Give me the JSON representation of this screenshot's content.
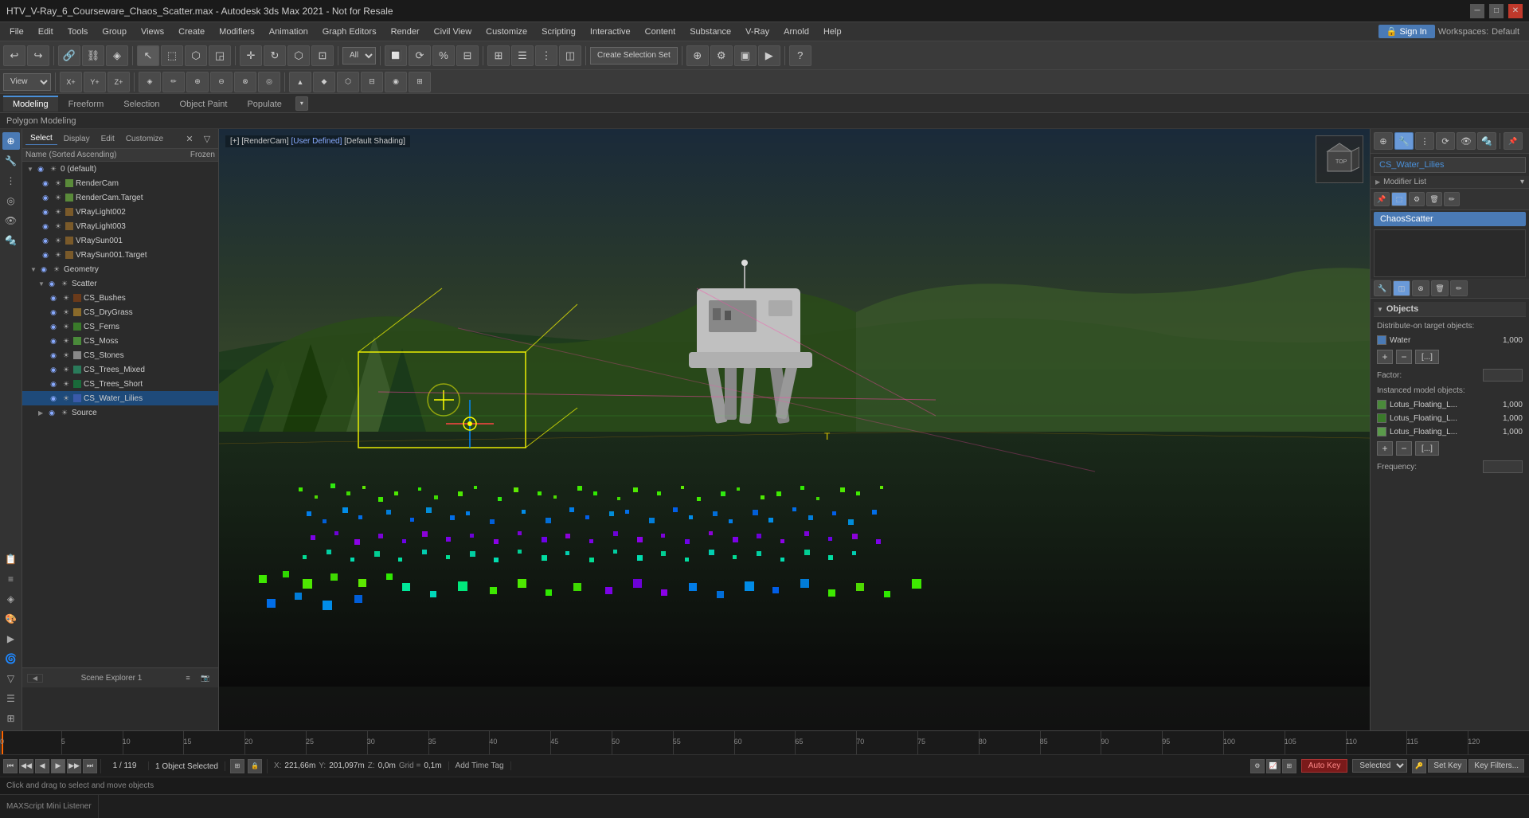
{
  "titleBar": {
    "title": "HTV_V-Ray_6_Courseware_Chaos_Scatter.max - Autodesk 3ds Max 2021 - Not for Resale",
    "minimize": "─",
    "maximize": "□",
    "close": "✕"
  },
  "menuBar": {
    "items": [
      "File",
      "Edit",
      "Tools",
      "Group",
      "Views",
      "Create",
      "Modifiers",
      "Animation",
      "Graph Editors",
      "Render",
      "Civil View",
      "Customize",
      "Scripting",
      "Interactive",
      "Content",
      "Substance",
      "V-Ray",
      "Arnold",
      "Help"
    ]
  },
  "signin": {
    "label": "🔒 Sign In",
    "workspaces": "Workspaces:",
    "workspaceValue": "Default"
  },
  "toolbar1": {
    "buttons": [
      "↩",
      "↪",
      "🔗",
      "🔗",
      "~",
      "▼",
      "■",
      "◆",
      "▲",
      "◎",
      "⚙",
      "⟳",
      "◎",
      "✦",
      "◈",
      "◫",
      "★",
      "❖",
      "⊕",
      "⊗",
      "⊘",
      "⊙"
    ],
    "dropdown": "All",
    "createSelectionSet": "Create Selection Set"
  },
  "toolbar2": {
    "viewportDropdown": "View",
    "buttons": [
      "⊕",
      "⊞",
      "◫",
      "◧",
      "⊟",
      "⊠"
    ]
  },
  "tabs": {
    "items": [
      "Modeling",
      "Freeform",
      "Selection",
      "Object Paint",
      "Populate"
    ],
    "activeIndex": 0,
    "dropdownIcon": "▾"
  },
  "subTitle": {
    "text": "Polygon Modeling"
  },
  "viewport": {
    "label": "[+] [RenderCam] [User Defined] [Default Shading]",
    "parts": {
      "plus": "[+]",
      "renderCam": "[RenderCam]",
      "userDefined": "[User Defined]",
      "defaultShading": "[Default Shading]"
    }
  },
  "sceneExplorer": {
    "title": "Scene Explorer 1",
    "headerTabs": [
      "Select",
      "Display",
      "Edit",
      "Customize"
    ],
    "columnHeaders": {
      "name": "Name (Sorted Ascending)",
      "frozen": "Frozen"
    },
    "items": [
      {
        "id": "0-default",
        "name": "0 (default)",
        "indent": 0,
        "type": "layer",
        "hasArrow": true,
        "expanded": true
      },
      {
        "id": "render-cam",
        "name": "RenderCam",
        "indent": 2,
        "type": "object",
        "hasArrow": false
      },
      {
        "id": "render-cam-target",
        "name": "RenderCam.Target",
        "indent": 2,
        "type": "object",
        "hasArrow": false
      },
      {
        "id": "vray-light002",
        "name": "VRayLight002",
        "indent": 2,
        "type": "object",
        "hasArrow": false
      },
      {
        "id": "vray-light003",
        "name": "VRayLight003",
        "indent": 2,
        "type": "object",
        "hasArrow": false
      },
      {
        "id": "vray-sun001",
        "name": "VRaySun001",
        "indent": 2,
        "type": "object",
        "hasArrow": false
      },
      {
        "id": "vray-sun001-target",
        "name": "VRaySun001.Target",
        "indent": 2,
        "type": "object",
        "hasArrow": false
      },
      {
        "id": "geometry",
        "name": "Geometry",
        "indent": 1,
        "type": "group",
        "hasArrow": true,
        "expanded": true
      },
      {
        "id": "scatter",
        "name": "Scatter",
        "indent": 2,
        "type": "group",
        "hasArrow": true,
        "expanded": true
      },
      {
        "id": "cs-bushes",
        "name": "CS_Bushes",
        "indent": 3,
        "type": "object"
      },
      {
        "id": "cs-drygrass",
        "name": "CS_DryGrass",
        "indent": 3,
        "type": "object"
      },
      {
        "id": "cs-ferns",
        "name": "CS_Ferns",
        "indent": 3,
        "type": "object"
      },
      {
        "id": "cs-moss",
        "name": "CS_Moss",
        "indent": 3,
        "type": "object"
      },
      {
        "id": "cs-stones",
        "name": "CS_Stones",
        "indent": 3,
        "type": "object"
      },
      {
        "id": "cs-trees-mixed",
        "name": "CS_Trees_Mixed",
        "indent": 3,
        "type": "object"
      },
      {
        "id": "cs-trees-short",
        "name": "CS_Trees_Short",
        "indent": 3,
        "type": "object"
      },
      {
        "id": "cs-water-lilies",
        "name": "CS_Water_Lilies",
        "indent": 3,
        "type": "object",
        "selected": true
      },
      {
        "id": "source",
        "name": "Source",
        "indent": 2,
        "type": "group",
        "hasArrow": true
      }
    ],
    "footer": {
      "navLabel": "Scene Explorer 1",
      "page": "1 / 119"
    }
  },
  "rightPanel": {
    "objectName": "CS_Water_Lilies",
    "modifierListLabel": "Modifier List",
    "modifierItem": "ChaosScatter",
    "objectsSection": {
      "title": "Objects",
      "distributeLabel": "Distribute-on target objects:",
      "targetObjects": [
        {
          "name": "Water",
          "value": "1,000",
          "color": "#4a7ab5"
        }
      ],
      "instancedLabel": "Instanced model objects:",
      "instancedObjects": [
        {
          "name": "Lotus_Floating_L...",
          "value": "1,000",
          "color": "#4a8a3a"
        },
        {
          "name": "Lotus_Floating_L...",
          "value": "1,000",
          "color": "#3a7a2a"
        },
        {
          "name": "Lotus_Floating_L...",
          "value": "1,000",
          "color": "#5a9a4a"
        }
      ],
      "factorLabel": "Factor:",
      "frequencyLabel": "Frequency:"
    }
  },
  "statusBar": {
    "selectedText": "1 Object Selected",
    "helpText": "Click and drag to select and move objects",
    "coords": {
      "x": "X: 221,66m",
      "y": "Y: 201,097m",
      "z": "Z: 0,0m",
      "grid": "Grid = 0,1m"
    },
    "addTimeTag": "Add Time Tag"
  },
  "playback": {
    "buttons": [
      "⏮",
      "◀◀",
      "◀",
      "▶",
      "▶▶",
      "⏭"
    ],
    "frameIndicator": "1 / 119"
  },
  "bottomRight": {
    "autoKey": "Auto Key",
    "selected": "Selected",
    "setKey": "Set Key",
    "keyFilters": "Key Filters..."
  },
  "maxscript": {
    "label": "MAXScript Mini Listener",
    "placeholder": ""
  },
  "timeline": {
    "ticks": [
      0,
      5,
      10,
      15,
      20,
      25,
      30,
      35,
      40,
      45,
      50,
      55,
      60,
      65,
      70,
      75,
      80,
      85,
      90,
      95,
      100,
      105,
      110,
      115,
      120
    ]
  }
}
